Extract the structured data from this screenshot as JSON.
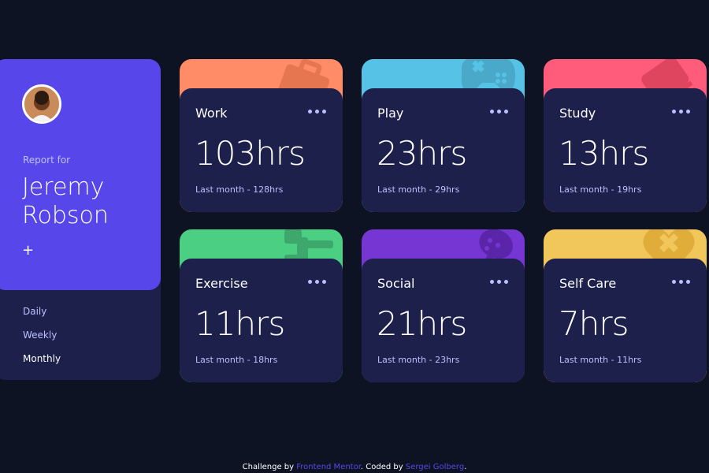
{
  "profile": {
    "report_for": "Report for",
    "first_name": "Jeremy",
    "last_name": "Robson",
    "add_symbol": "+",
    "periods": [
      {
        "label": "Daily",
        "active": false
      },
      {
        "label": "Weekly",
        "active": false
      },
      {
        "label": "Monthly",
        "active": true
      }
    ]
  },
  "cards": [
    {
      "title": "Work",
      "hours": "103hrs",
      "previous": "Last month - 128hrs",
      "color": "#ff8c66",
      "icon": "briefcase-icon"
    },
    {
      "title": "Play",
      "hours": "23hrs",
      "previous": "Last month - 29hrs",
      "color": "#56c2e6",
      "icon": "gamepad-icon"
    },
    {
      "title": "Study",
      "hours": "13hrs",
      "previous": "Last month - 19hrs",
      "color": "#ff5c7c",
      "icon": "book-icon"
    },
    {
      "title": "Exercise",
      "hours": "11hrs",
      "previous": "Last month - 18hrs",
      "color": "#4bcf83",
      "icon": "runner-icon"
    },
    {
      "title": "Social",
      "hours": "21hrs",
      "previous": "Last month - 23hrs",
      "color": "#7536d3",
      "icon": "balloon-icon"
    },
    {
      "title": "Self Care",
      "hours": "7hrs",
      "previous": "Last month - 11hrs",
      "color": "#f1c65b",
      "icon": "heart-icon"
    }
  ],
  "footer": {
    "prefix": "Challenge by ",
    "link1": "Frontend Mentor",
    "middle": ". Coded by ",
    "link2": "Sergei Golberg",
    "suffix": "."
  },
  "colors": {
    "page_bg": "#0d1323",
    "card_bg": "#1c204b",
    "accent": "#5747ea",
    "muted": "#bbc0ff"
  }
}
